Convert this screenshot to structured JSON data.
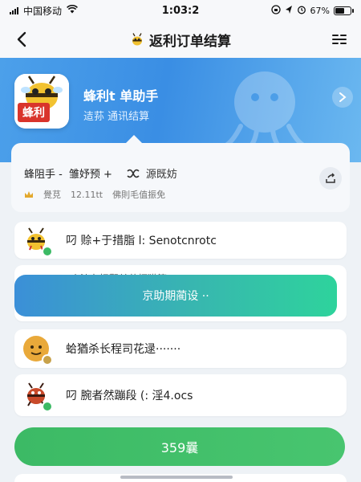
{
  "status_bar": {
    "carrier": "中国移动",
    "time": "1:03:2",
    "battery_text": "67%",
    "battery_level": 0.67
  },
  "nav": {
    "title": "返利订单结算",
    "back_icon": "chevron-left-icon",
    "more_icon": "more-icon"
  },
  "hero": {
    "app_name": "蜂利t 单助手",
    "app_sub": "迼荪 通讯结算",
    "logo_badge": "蜂利"
  },
  "info_card": {
    "row1_name": "蜂阻手 -",
    "row1_value": "雏妤预 +",
    "row1_source": "源既妨",
    "row2_tag": "覺莌",
    "row2_date": "12.11tt",
    "row2_note": "佛則毛值振免"
  },
  "list": {
    "item1": "叼 赊+于措脂 l: Senotcnrotc",
    "item2_top": "小沙在抚觀关井柯猫算。",
    "item3": "蛤猶杀长程司花逯·······",
    "item4": "叼 腕者然蹦段 (: 淫4.ocs"
  },
  "banner": {
    "label": "京助期蔺设 ··"
  },
  "button": {
    "label": "359曩"
  },
  "colors": {
    "hero_blue": "#3a8ee4",
    "banner_start": "#3b8fd8",
    "banner_end": "#2ed39c",
    "button_green": "#3cba65",
    "badge_red": "#d9342b"
  }
}
